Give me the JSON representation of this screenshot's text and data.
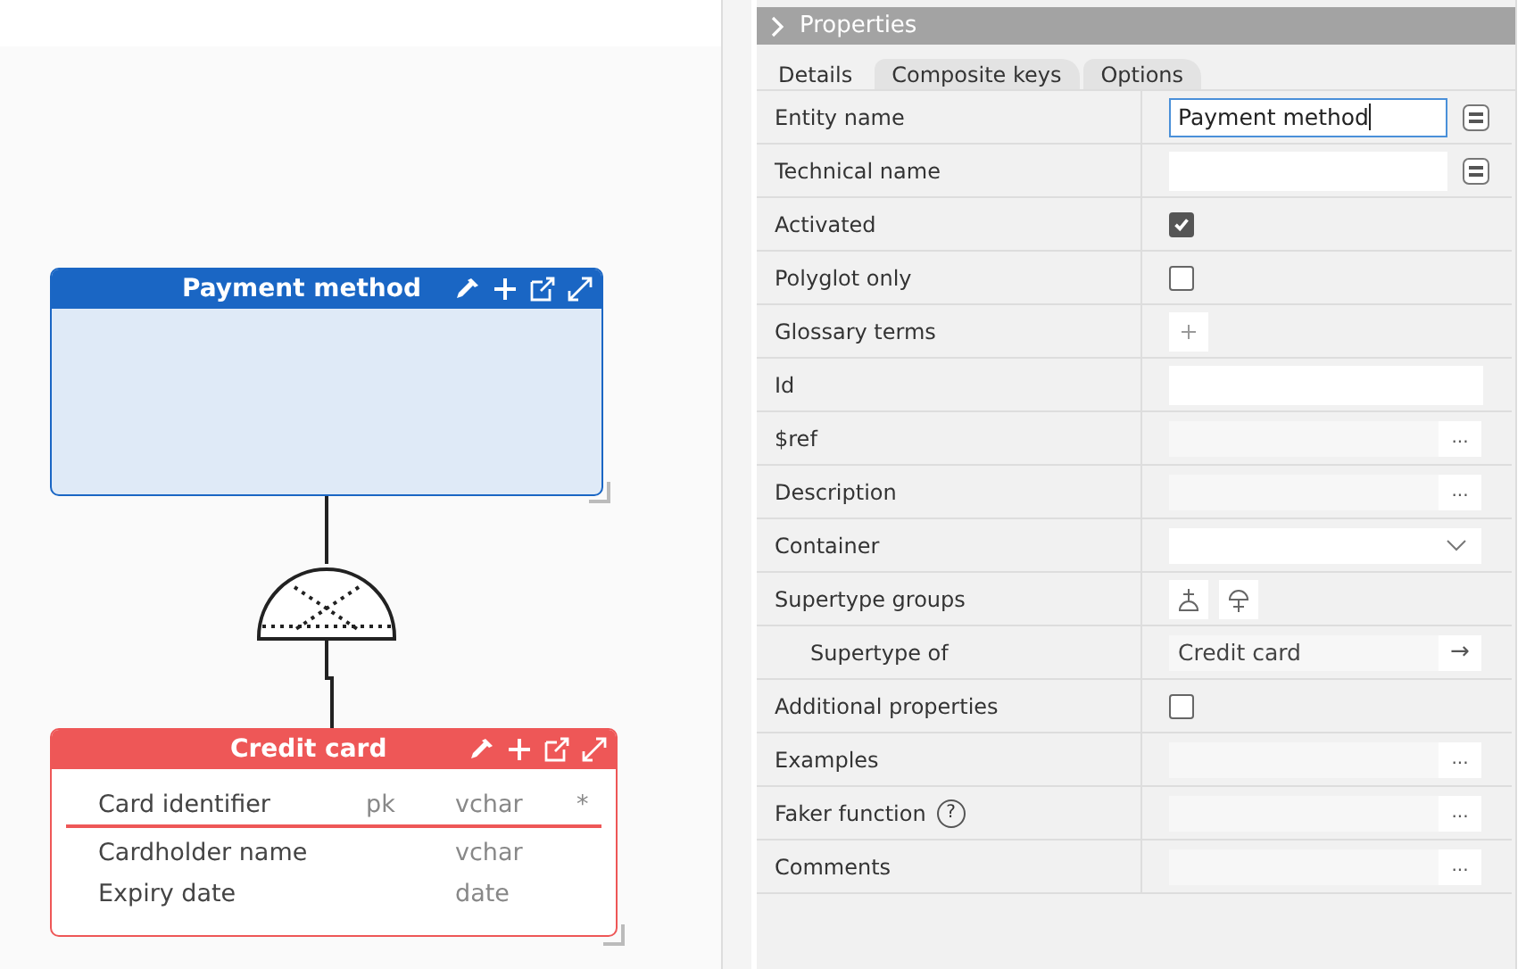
{
  "canvas": {
    "entities": [
      {
        "name": "Payment method",
        "color": "#1a66c4",
        "selected": true
      },
      {
        "name": "Credit card",
        "color": "#ee5757",
        "selected": false,
        "attributes": [
          {
            "name": "Card identifier",
            "key": "pk",
            "type": "vchar",
            "required": "*"
          },
          {
            "name": "Cardholder name",
            "type": "vchar"
          },
          {
            "name": "Expiry date",
            "type": "date"
          }
        ]
      }
    ]
  },
  "properties": {
    "title": "Properties",
    "expanded": true,
    "tabs": [
      {
        "label": "Details",
        "selected": true
      },
      {
        "label": "Composite keys",
        "selected": false
      },
      {
        "label": "Options",
        "selected": false
      }
    ],
    "rows": [
      {
        "label": "Entity name",
        "kind": "text",
        "value": "Payment method",
        "focused": true
      },
      {
        "label": "Technical name",
        "kind": "text",
        "focused": false
      },
      {
        "label": "Activated",
        "kind": "checkbox",
        "checked": true
      },
      {
        "label": "Polyglot only",
        "kind": "checkbox",
        "checked": false
      },
      {
        "label": "Glossary terms",
        "kind": "add"
      },
      {
        "label": "Id",
        "kind": "plain"
      },
      {
        "label": "$ref",
        "kind": "dots",
        "button": "..."
      },
      {
        "label": "Description",
        "kind": "dots",
        "button": "..."
      },
      {
        "label": "Container",
        "kind": "select"
      },
      {
        "label": "Supertype groups",
        "kind": "groups",
        "children": [
          {
            "label": "Supertype of",
            "kind": "link",
            "value": "Credit card",
            "button": "→"
          }
        ]
      },
      {
        "label": "Additional properties",
        "kind": "checkbox",
        "checked": false
      },
      {
        "label": "Examples",
        "kind": "dots",
        "button": "..."
      },
      {
        "label": "Faker function",
        "kind": "dots",
        "help": "?",
        "button": "..."
      },
      {
        "label": "Comments",
        "kind": "dots",
        "button": "..."
      }
    ]
  }
}
